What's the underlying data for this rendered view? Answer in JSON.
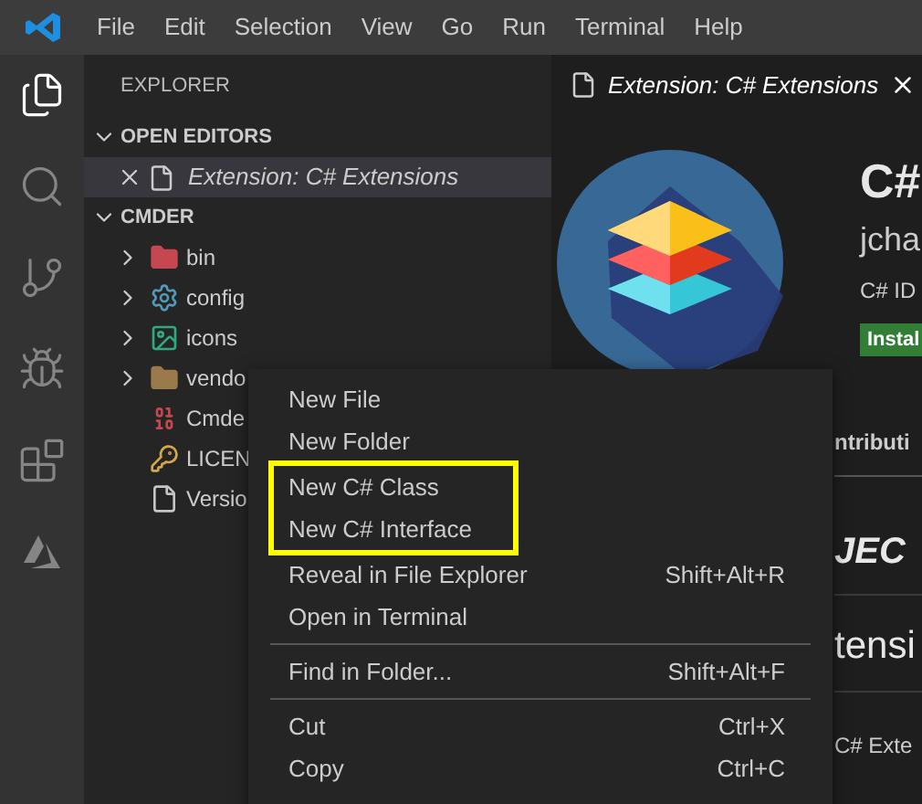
{
  "menubar": [
    "File",
    "Edit",
    "Selection",
    "View",
    "Go",
    "Run",
    "Terminal",
    "Help"
  ],
  "activity_bar": [
    {
      "kind": "files",
      "selected": true
    },
    {
      "kind": "search",
      "selected": false
    },
    {
      "kind": "source-control",
      "selected": false
    },
    {
      "kind": "debug",
      "selected": false
    },
    {
      "kind": "extensions",
      "selected": false
    },
    {
      "kind": "azure",
      "selected": false
    }
  ],
  "sidebar": {
    "title": "EXPLORER",
    "open_editors": {
      "title": "OPEN EDITORS",
      "expanded": true,
      "items": [
        {
          "label": "Extension: C# Extensions",
          "selected": true
        }
      ]
    },
    "folder": {
      "title": "CMDER",
      "expanded": true,
      "children": [
        {
          "label": "bin",
          "kind": "bin-folder",
          "expanded": false
        },
        {
          "label": "config",
          "kind": "config-folder",
          "expanded": false
        },
        {
          "label": "icons",
          "kind": "image-folder",
          "expanded": false
        },
        {
          "label": "vendo",
          "kind": "folder",
          "expanded": false
        },
        {
          "label": "Cmde",
          "kind": "binary-file"
        },
        {
          "label": "LICEN",
          "kind": "license-file"
        },
        {
          "label": "Versio",
          "kind": "file"
        }
      ]
    }
  },
  "editor": {
    "tab": {
      "label": "Extension: C# Extensions",
      "selected": true
    },
    "title": "C#",
    "publisher": "jcha",
    "description": "C# ID",
    "install_button": "Instal",
    "tab_strip_label": "ntributi",
    "heading": "JEC",
    "subheading": "tensi",
    "text": "C# Exte"
  },
  "context_menu": {
    "sections": [
      {
        "items": [
          {
            "label": "New File",
            "highlighted": false
          },
          {
            "label": "New Folder",
            "highlighted": false
          },
          {
            "label": "New C# Class",
            "highlighted": true
          },
          {
            "label": "New C# Interface",
            "highlighted": true
          },
          {
            "label": "Reveal in File Explorer",
            "shortcut": "Shift+Alt+R",
            "highlighted": false
          },
          {
            "label": "Open in Terminal",
            "highlighted": false
          }
        ]
      },
      {
        "items": [
          {
            "label": "Find in Folder...",
            "shortcut": "Shift+Alt+F",
            "highlighted": false
          }
        ]
      },
      {
        "items": [
          {
            "label": "Cut",
            "shortcut": "Ctrl+X",
            "highlighted": false
          },
          {
            "label": "Copy",
            "shortcut": "Ctrl+C",
            "highlighted": false
          }
        ]
      }
    ]
  }
}
